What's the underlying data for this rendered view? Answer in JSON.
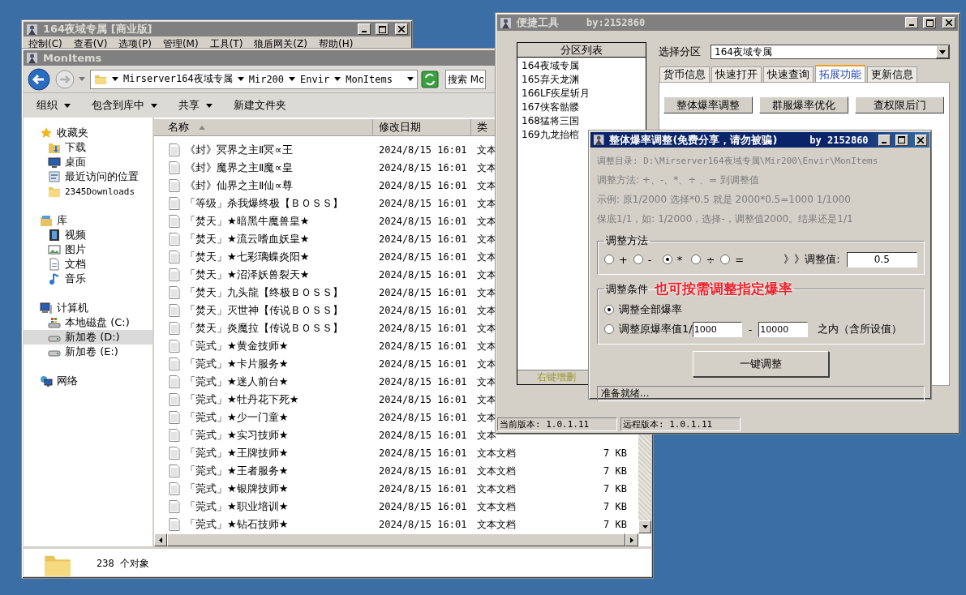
{
  "main_window": {
    "title": "164夜域专属 [商业版]",
    "active": false,
    "menu": [
      "控制(C)",
      "查看(V)",
      "选项(P)",
      "管理(M)",
      "工具(T)",
      "狼盾网关(Z)",
      "帮助(H)"
    ]
  },
  "explorer": {
    "title": "MonItems",
    "active": false,
    "breadcrumb": [
      "Mirserver164夜域专属",
      "Mir200",
      "Envir",
      "MonItems"
    ],
    "search": {
      "placeholder": "搜索 Mo"
    },
    "toolbar": [
      {
        "label": "组织",
        "dropdown": true
      },
      {
        "label": "包含到库中",
        "dropdown": true
      },
      {
        "label": "共享",
        "dropdown": true
      },
      {
        "label": "新建文件夹",
        "dropdown": false
      }
    ],
    "nav": [
      {
        "label": "收藏夹",
        "kind": "favorites",
        "selected": false,
        "children": [
          {
            "label": "下载",
            "kind": "downloads",
            "selected": false
          },
          {
            "label": "桌面",
            "kind": "desktop",
            "selected": false
          },
          {
            "label": "最近访问的位置",
            "kind": "recent",
            "selected": false
          },
          {
            "label": "2345Downloads",
            "kind": "folder",
            "selected": false
          }
        ]
      },
      {
        "label": "库",
        "kind": "library",
        "selected": false,
        "children": [
          {
            "label": "视频",
            "kind": "video",
            "selected": false
          },
          {
            "label": "图片",
            "kind": "pictures",
            "selected": false
          },
          {
            "label": "文档",
            "kind": "documents",
            "selected": false
          },
          {
            "label": "音乐",
            "kind": "music",
            "selected": false
          }
        ]
      },
      {
        "label": "计算机",
        "kind": "computer",
        "selected": false,
        "children": [
          {
            "label": "本地磁盘 (C:)",
            "kind": "system_drive",
            "selected": false
          },
          {
            "label": "新加卷 (D:)",
            "kind": "drive",
            "selected": true
          },
          {
            "label": "新加卷 (E:)",
            "kind": "drive",
            "selected": false
          }
        ]
      },
      {
        "label": "网络",
        "kind": "network",
        "selected": false
      }
    ],
    "columns": [
      {
        "label": "名称",
        "sorted": true
      },
      {
        "label": "修改日期"
      },
      {
        "label": "类"
      }
    ],
    "rows": [
      {
        "name": "《封》冥界之主Ⅱ冥∝王",
        "date": "2024/8/15 16:01",
        "type": "文本"
      },
      {
        "name": "《封》魔界之主Ⅱ魔∝皇",
        "date": "2024/8/15 16:01",
        "type": "文本"
      },
      {
        "name": "《封》仙界之主Ⅱ仙∝尊",
        "date": "2024/8/15 16:01",
        "type": "文本"
      },
      {
        "name": "「等级」杀我爆终极【ＢＯＳＳ】",
        "date": "2024/8/15 16:01",
        "type": "文本"
      },
      {
        "name": "「焚天」★暗黑牛魔兽皇★",
        "date": "2024/8/15 16:01",
        "type": "文本"
      },
      {
        "name": "「焚天」★流云嗜血妖皇★",
        "date": "2024/8/15 16:01",
        "type": "文本"
      },
      {
        "name": "「焚天」★七彩璃蝶炎阳★",
        "date": "2024/8/15 16:01",
        "type": "文本"
      },
      {
        "name": "「焚天」★沼泽妖兽裂天★",
        "date": "2024/8/15 16:01",
        "type": "文本"
      },
      {
        "name": "「焚天」九头龍【终极ＢＯＳＳ】",
        "date": "2024/8/15 16:01",
        "type": "文本"
      },
      {
        "name": "「焚天」灭世神【传说ＢＯＳＳ】",
        "date": "2024/8/15 16:01",
        "type": "文本"
      },
      {
        "name": "「焚天」炎魔拉【传说ＢＯＳＳ】",
        "date": "2024/8/15 16:01",
        "type": "文本"
      },
      {
        "name": "「莞式」★黄金技师★",
        "date": "2024/8/15 16:01",
        "type": "文本"
      },
      {
        "name": "「莞式」★卡片服务★",
        "date": "2024/8/15 16:01",
        "type": "文本"
      },
      {
        "name": "「莞式」★迷人前台★",
        "date": "2024/8/15 16:01",
        "type": "文本"
      },
      {
        "name": "「莞式」★牡丹花下死★",
        "date": "2024/8/15 16:01",
        "type": "文本"
      },
      {
        "name": "「莞式」★少一门童★",
        "date": "2024/8/15 16:01",
        "type": "文本"
      },
      {
        "name": "「莞式」★实习技师★",
        "date": "2024/8/15 16:01",
        "type": "文本"
      },
      {
        "name": "「莞式」★王牌技师★",
        "date": "2024/8/15 16:01",
        "type": "文本文档",
        "size": "7 KB"
      },
      {
        "name": "「莞式」★王者服务★",
        "date": "2024/8/15 16:01",
        "type": "文本文档",
        "size": "7 KB"
      },
      {
        "name": "「莞式」★银牌技师★",
        "date": "2024/8/15 16:01",
        "type": "文本文档",
        "size": "7 KB"
      },
      {
        "name": "「莞式」★职业培训★",
        "date": "2024/8/15 16:01",
        "type": "文本文档",
        "size": "7 KB"
      },
      {
        "name": "「莞式」★钻石技师★",
        "date": "2024/8/15 16:01",
        "type": "文本文档",
        "size": "7 KB"
      }
    ],
    "status": "238 个对象"
  },
  "tool_window": {
    "title": "便捷工具",
    "author": "by:2152860",
    "active": false,
    "list": {
      "header": "分区列表",
      "items": [
        "164夜域专属",
        "165弃天龙渊",
        "166LF疾星斩月",
        "167侠客骷髅",
        "168猛将三国",
        "169九龙抬棺"
      ],
      "footer": "右键增删"
    },
    "select_label": "选择分区",
    "select_value": "164夜域专属",
    "tabs": [
      {
        "label": "货币信息",
        "selected": false
      },
      {
        "label": "快速打开",
        "selected": false
      },
      {
        "label": "快速查询",
        "selected": false
      },
      {
        "label": "拓展功能",
        "selected": true
      },
      {
        "label": "更新信息",
        "selected": false
      }
    ],
    "buttons": [
      "整体爆率调整",
      "群服爆率优化",
      "查权限后门"
    ],
    "status": [
      "当前版本: 1.0.1.11",
      "远程版本: 1.0.1.11"
    ]
  },
  "dialog": {
    "title": "整体爆率调整(免费分享，请勿被骗)",
    "author": "by 2152860",
    "active": true,
    "info": [
      "调整目录: D:\\Mirserver164夜域专属\\Mir200\\Envir\\MonItems",
      "调整方法: +、-、*、÷ 、=   到调整值",
      "示例: 原1/2000 选择*0.5 就是 2000*0.5=1000  1/1000",
      "保底1/1，如: 1/2000，选择-，调整值2000。结果还是1/1"
    ],
    "method": {
      "title": "调整方法",
      "options": [
        {
          "label": "+",
          "selected": false
        },
        {
          "label": "-",
          "selected": false
        },
        {
          "label": "*",
          "selected": true
        },
        {
          "label": "÷",
          "selected": false
        },
        {
          "label": "=",
          "selected": false
        }
      ],
      "value_label": "》》调整值:",
      "value": "0.5"
    },
    "condition": {
      "title": "调整条件",
      "annotation": "也可按需调整指定爆率",
      "options": [
        {
          "kind": "plain",
          "label": "调整全部爆率",
          "selected": true
        },
        {
          "kind": "range",
          "label": "调整原爆率值1/",
          "from": "1000",
          "separator": "-",
          "to": "10000",
          "suffix": "之内（含所设值）",
          "selected": false
        }
      ]
    },
    "action": "一键调整",
    "status": "准备就绪..."
  }
}
